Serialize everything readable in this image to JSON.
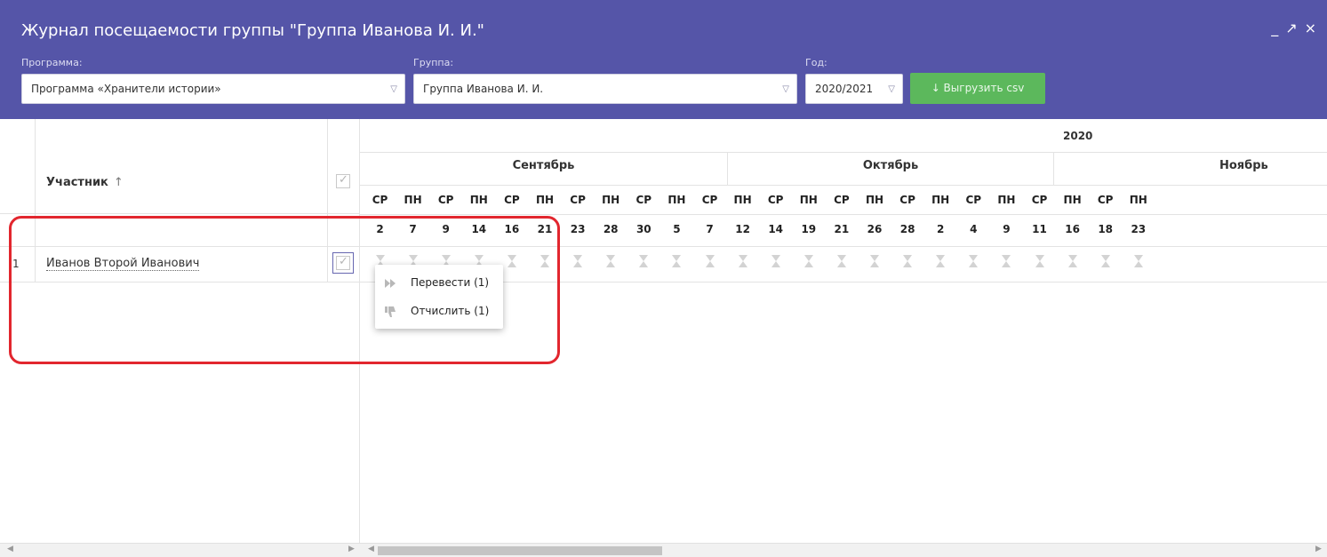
{
  "window": {
    "title": "Журнал посещаемости группы \"Группа Иванова И. И.\"",
    "controls": [
      "_",
      "↗",
      "×"
    ]
  },
  "filters": {
    "program_label": "Программа:",
    "program_value": "Программа «Хранители истории»",
    "group_label": "Группа:",
    "group_value": "Группа Иванова И. И.",
    "year_label": "Год:",
    "year_value": "2020/2021",
    "export_label": "↓ Выгрузить csv"
  },
  "grid": {
    "participant_header": "Участник",
    "sort_icon": "↑",
    "year": "2020",
    "months": [
      "Сентябрь",
      "Октябрь",
      "Ноябрь"
    ],
    "columns": [
      {
        "dow": "СР",
        "day": "2"
      },
      {
        "dow": "ПН",
        "day": "7"
      },
      {
        "dow": "СР",
        "day": "9"
      },
      {
        "dow": "ПН",
        "day": "14"
      },
      {
        "dow": "СР",
        "day": "16"
      },
      {
        "dow": "ПН",
        "day": "21"
      },
      {
        "dow": "СР",
        "day": "23"
      },
      {
        "dow": "ПН",
        "day": "28"
      },
      {
        "dow": "СР",
        "day": "30"
      },
      {
        "dow": "ПН",
        "day": "5"
      },
      {
        "dow": "СР",
        "day": "7"
      },
      {
        "dow": "ПН",
        "day": "12"
      },
      {
        "dow": "СР",
        "day": "14"
      },
      {
        "dow": "ПН",
        "day": "19"
      },
      {
        "dow": "СР",
        "day": "21"
      },
      {
        "dow": "ПН",
        "day": "26"
      },
      {
        "dow": "СР",
        "day": "28"
      },
      {
        "dow": "ПН",
        "day": "2"
      },
      {
        "dow": "СР",
        "day": "4"
      },
      {
        "dow": "ПН",
        "day": "9"
      },
      {
        "dow": "СР",
        "day": "11"
      },
      {
        "dow": "ПН",
        "day": "16"
      },
      {
        "dow": "СР",
        "day": "18"
      },
      {
        "dow": "ПН",
        "day": "23"
      }
    ],
    "rows": [
      {
        "num": "1",
        "name": "Иванов Второй Иванович"
      }
    ]
  },
  "context_menu": {
    "items": [
      {
        "label": "Перевести (1)",
        "icon": "fast-forward-icon"
      },
      {
        "label": "Отчислить (1)",
        "icon": "thumbs-down-icon"
      }
    ]
  },
  "colors": {
    "header_bg": "#5555a8",
    "export_btn": "#5cb85c",
    "highlight": "#e2262e"
  }
}
